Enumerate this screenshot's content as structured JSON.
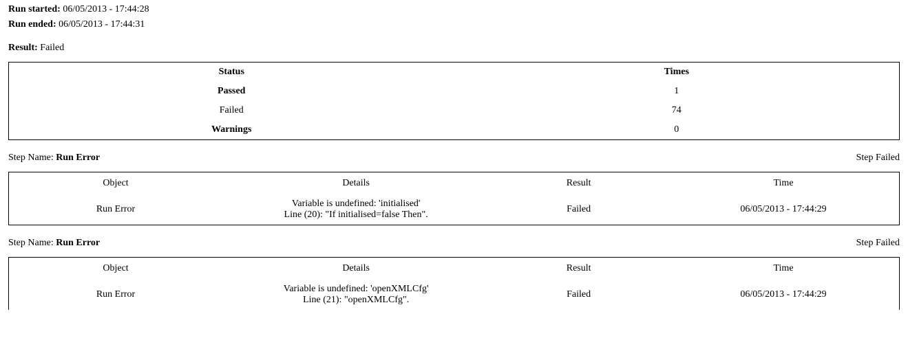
{
  "meta": {
    "run_started_label": "Run started:",
    "run_started_value": "06/05/2013 - 17:44:28",
    "run_ended_label": "Run ended:",
    "run_ended_value": "06/05/2013 - 17:44:31",
    "result_label": "Result:",
    "result_value": "Failed"
  },
  "summary": {
    "col1_header": "Status",
    "col2_header": "Times",
    "rows": [
      {
        "status": "Passed",
        "status_bold": true,
        "times": "1"
      },
      {
        "status": "Failed",
        "status_bold": false,
        "times": "74"
      },
      {
        "status": "Warnings",
        "status_bold": true,
        "times": "0"
      }
    ]
  },
  "step_labels": {
    "step_name_label": "Step Name:",
    "step_status_label_failed": "Step Failed"
  },
  "details_headers": {
    "object": "Object",
    "details": "Details",
    "result": "Result",
    "time": "Time"
  },
  "steps": [
    {
      "name": "Run Error",
      "status": "Step Failed",
      "object": "Run Error",
      "detail_line1": "Variable is undefined: 'initialised'",
      "detail_line2": "Line (20): \"If initialised=false Then\".",
      "result": "Failed",
      "time": "06/05/2013 - 17:44:29"
    },
    {
      "name": "Run Error",
      "status": "Step Failed",
      "object": "Run Error",
      "detail_line1": "Variable is undefined: 'openXMLCfg'",
      "detail_line2": "Line (21): \"openXMLCfg\".",
      "result": "Failed",
      "time": "06/05/2013 - 17:44:29"
    }
  ]
}
